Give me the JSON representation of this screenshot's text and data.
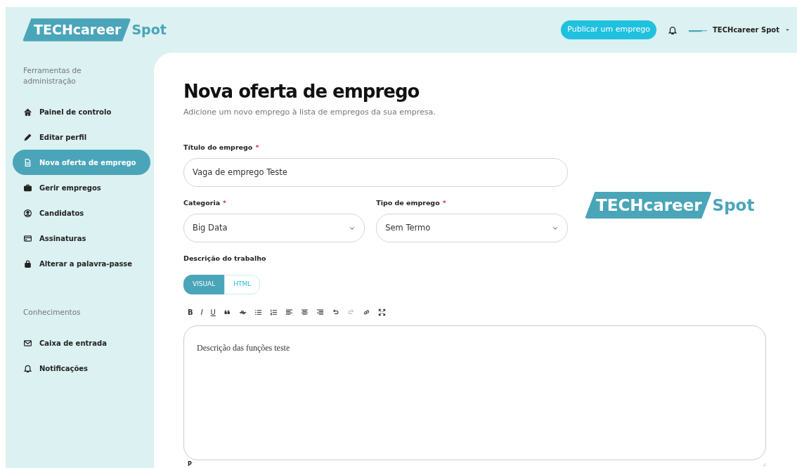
{
  "header": {
    "logo": {
      "main": "TECHcareer",
      "accent": "Spot"
    },
    "post_button": "Publicar um emprego",
    "account": "TECHcareer Spot"
  },
  "sidebar": {
    "sections": [
      {
        "title": "Ferramentas de administração",
        "items": [
          {
            "label": "Painel de controlo",
            "selected": false
          },
          {
            "label": "Editar perfil",
            "selected": false
          },
          {
            "label": "Nova oferta de emprego",
            "selected": true
          },
          {
            "label": "Gerir empregos",
            "selected": false
          },
          {
            "label": "Candidatos",
            "selected": false
          },
          {
            "label": "Assinaturas",
            "selected": false
          },
          {
            "label": "Alterar a palavra-passe",
            "selected": false
          }
        ]
      },
      {
        "title": "Conhecimentos",
        "items": [
          {
            "label": "Caixa de entrada",
            "selected": false
          },
          {
            "label": "Notificações",
            "selected": false
          }
        ]
      }
    ]
  },
  "page": {
    "title": "Nova oferta de emprego",
    "subtitle": "Adicione um novo emprego à lista de empregos da sua empresa.",
    "logo": {
      "main": "TECHcareer",
      "accent": "Spot"
    },
    "job_title": {
      "label": "Título do emprego",
      "required_mark": "*",
      "value": "Vaga de emprego Teste"
    },
    "category": {
      "label": "Categoria",
      "required_mark": "*",
      "value": "Big Data"
    },
    "job_type": {
      "label": "Tipo de emprego",
      "required_mark": "*",
      "value": "Sem Termo"
    },
    "description": {
      "label": "Descrição do trabalho",
      "modes": [
        {
          "label": "VISUAL",
          "selected": true
        },
        {
          "label": "HTML",
          "selected": false
        }
      ],
      "toolbar": [
        {
          "kind": "letter",
          "text": "B"
        },
        {
          "kind": "letter",
          "text": "I"
        },
        {
          "kind": "letter",
          "text": "U"
        },
        {
          "kind": "icon"
        },
        {
          "kind": "icon"
        },
        {
          "kind": "icon"
        },
        {
          "kind": "icon"
        },
        {
          "kind": "icon"
        },
        {
          "kind": "icon"
        },
        {
          "kind": "icon"
        },
        {
          "kind": "icon",
          "disabled": false
        },
        {
          "kind": "icon",
          "disabled": true
        },
        {
          "kind": "icon"
        },
        {
          "kind": "icon"
        }
      ],
      "content": "Descrição das funções teste",
      "path": "P"
    }
  }
}
